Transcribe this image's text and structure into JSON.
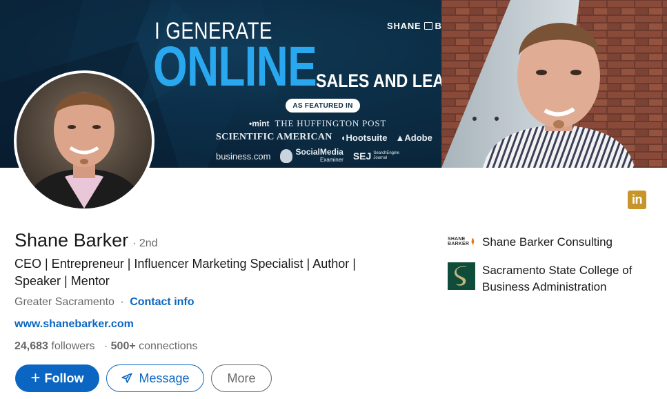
{
  "banner": {
    "headline_1": "I GENERATE",
    "headline_2": "ONLINE",
    "headline_3": "SALES AND LEADS",
    "brand": "SHANE BARKER",
    "featured_label": "AS FEATURED IN",
    "press": {
      "mint": "mint",
      "huffington": "THE HUFFINGTON POST",
      "sciam": "SCIENTIFIC AMERICAN",
      "hootsuite": "Hootsuite",
      "adobe": "Adobe",
      "business": "business.com",
      "social_media": "SocialMedia",
      "social_media_sub": "Examiner",
      "sej": "SEJ",
      "sej_sub_1": "SearchEngine",
      "sej_sub_2": "Journal"
    },
    "colors": {
      "accent": "#29a8f0",
      "background": "#0b2a42"
    }
  },
  "profile": {
    "name": "Shane Barker",
    "degree": "· 2nd",
    "headline": "CEO | Entrepreneur | Influencer Marketing Specialist | Author | Speaker | Mentor",
    "location": "Greater Sacramento",
    "location_sep": "·",
    "contact_info": "Contact info",
    "website": "www.shanebarker.com",
    "followers_count": "24,683",
    "followers_label": "followers",
    "connections_sep": "·",
    "connections_count": "500+",
    "connections_label": "connections"
  },
  "actions": {
    "follow": "Follow",
    "follow_icon": "plus-icon",
    "message": "Message",
    "message_icon": "send-icon",
    "more": "More"
  },
  "badge": {
    "icon": "linkedin-icon",
    "label": "in",
    "color": "#c8952c"
  },
  "organizations": [
    {
      "name": "Shane Barker Consulting",
      "logo": "shane-barker-logo",
      "logo_text_1": "SHANE",
      "logo_text_2": "BARKER"
    },
    {
      "name": "Sacramento State College of Business Administration",
      "logo": "sacramento-state-logo"
    }
  ],
  "colors": {
    "link": "#0a66c2",
    "primary_button": "#0a66c2",
    "text_secondary": "#666666"
  }
}
